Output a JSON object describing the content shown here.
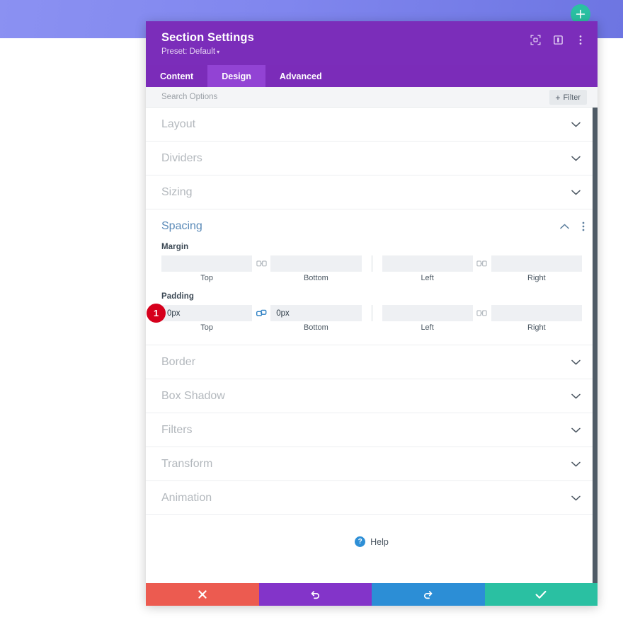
{
  "background": {
    "add_section_icon": "plus-circle-icon",
    "band_color_left": "#8b91f2",
    "band_color_right": "#6d75e2"
  },
  "modal": {
    "title": "Section Settings",
    "preset_label": "Preset: Default",
    "header_color": "#7b2cb9",
    "header_icons": [
      {
        "name": "responsive-preview-icon"
      },
      {
        "name": "layout-panel-icon"
      },
      {
        "name": "kebab-menu-icon"
      }
    ],
    "tabs": [
      {
        "label": "Content",
        "active": false
      },
      {
        "label": "Design",
        "active": true
      },
      {
        "label": "Advanced",
        "active": false
      }
    ],
    "active_tab_color": "#9243d4"
  },
  "search": {
    "placeholder": "Search Options",
    "value": "",
    "filter_label": "Filter",
    "filter_plus": "+"
  },
  "sections": [
    {
      "title": "Layout",
      "open": false
    },
    {
      "title": "Dividers",
      "open": false
    },
    {
      "title": "Sizing",
      "open": false
    }
  ],
  "spacing": {
    "title": "Spacing",
    "open": true,
    "accent_color": "#5a8ab8",
    "groups": [
      {
        "label": "Margin",
        "badge": null,
        "fields": [
          {
            "position": "Top",
            "value": "",
            "placeholder": ""
          },
          {
            "position": "Bottom",
            "value": "",
            "placeholder": ""
          },
          {
            "position": "Left",
            "value": "",
            "placeholder": ""
          },
          {
            "position": "Right",
            "value": "",
            "placeholder": ""
          }
        ],
        "link_left_linked": false,
        "link_right_linked": false
      },
      {
        "label": "Padding",
        "badge": "1",
        "badge_color": "#d6001c",
        "fields": [
          {
            "position": "Top",
            "value": "0px",
            "placeholder": ""
          },
          {
            "position": "Bottom",
            "value": "0px",
            "placeholder": ""
          },
          {
            "position": "Left",
            "value": "",
            "placeholder": ""
          },
          {
            "position": "Right",
            "value": "",
            "placeholder": ""
          }
        ],
        "link_left_linked": true,
        "link_right_linked": false
      }
    ]
  },
  "sections_after": [
    {
      "title": "Border",
      "open": false
    },
    {
      "title": "Box Shadow",
      "open": false
    },
    {
      "title": "Filters",
      "open": false
    },
    {
      "title": "Transform",
      "open": false
    },
    {
      "title": "Animation",
      "open": false
    }
  ],
  "help": {
    "label": "Help",
    "icon": "question-mark-circle-icon",
    "icon_color": "#2e8fd6"
  },
  "footer": {
    "buttons": [
      {
        "name": "cancel-button",
        "icon": "close-x-icon",
        "color": "#ec5b50"
      },
      {
        "name": "undo-button",
        "icon": "undo-arrow-icon",
        "color": "#8334c9"
      },
      {
        "name": "redo-button",
        "icon": "redo-arrow-icon",
        "color": "#2c8ed6"
      },
      {
        "name": "save-button",
        "icon": "checkmark-icon",
        "color": "#2ac0a2"
      }
    ]
  }
}
